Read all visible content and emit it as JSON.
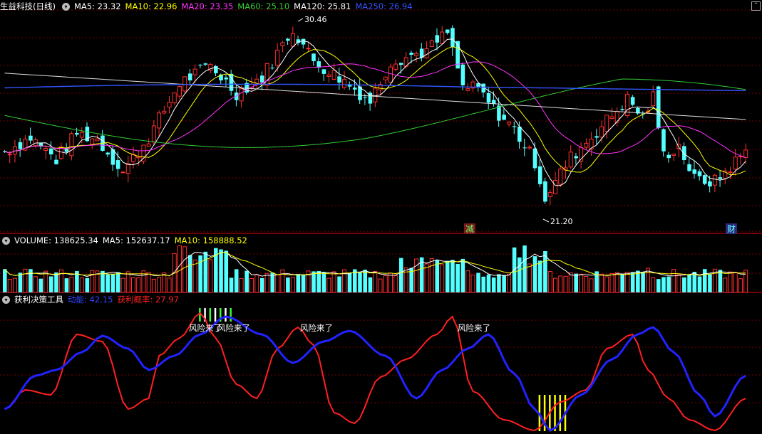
{
  "header": {
    "title": "生益科技(日线)",
    "ma": [
      {
        "label": "MA5: 23.32",
        "color": "#ffffff"
      },
      {
        "label": "MA10: 22.96",
        "color": "#ffff00"
      },
      {
        "label": "MA20: 23.35",
        "color": "#ff33ff"
      },
      {
        "label": "MA60: 25.10",
        "color": "#33cc33"
      },
      {
        "label": "MA120: 25.81",
        "color": "#ffffff"
      },
      {
        "label": "MA250: 26.94",
        "color": "#3355ff"
      }
    ]
  },
  "volume_header": {
    "title": "VOLUME: 138625.34",
    "ma5": "MA5: 152637.17",
    "ma10": "MA10: 158888.52"
  },
  "indicator_header": {
    "title": "获利决策工具",
    "l1": "动能: 42.15",
    "l2": "获利概率: 27.97"
  },
  "colors": {
    "up": "#ff3030",
    "down": "#54ffff",
    "background": "#000000",
    "grid": "#7a0000"
  },
  "chart_data": [
    {
      "type": "candlestick",
      "title": "生益科技(日线)",
      "annotations": [
        {
          "text": "30.46",
          "type": "high"
        },
        {
          "text": "21.20",
          "type": "low"
        },
        {
          "text": "减",
          "type": "event"
        },
        {
          "text": "财",
          "type": "event"
        }
      ],
      "moving_averages": [
        "MA5",
        "MA10",
        "MA20",
        "MA60",
        "MA120",
        "MA250"
      ],
      "values": {
        "MA5": 23.32,
        "MA10": 22.96,
        "MA20": 23.35,
        "MA60": 25.1,
        "MA120": 25.81,
        "MA250": 26.94
      },
      "price_range": [
        21.2,
        30.46
      ]
    },
    {
      "type": "bar",
      "title": "VOLUME",
      "values": {
        "VOLUME": 138625.34,
        "MA5": 152637.17,
        "MA10": 158888.52
      }
    },
    {
      "type": "line",
      "title": "获利决策工具",
      "series": [
        {
          "name": "动能",
          "value": 42.15,
          "color": "#2222ff"
        },
        {
          "name": "获利概率",
          "value": 27.97,
          "color": "#ff2020"
        }
      ],
      "annotations": [
        "风险来了",
        "风险来了",
        "风险来了",
        "风险来了"
      ]
    }
  ]
}
